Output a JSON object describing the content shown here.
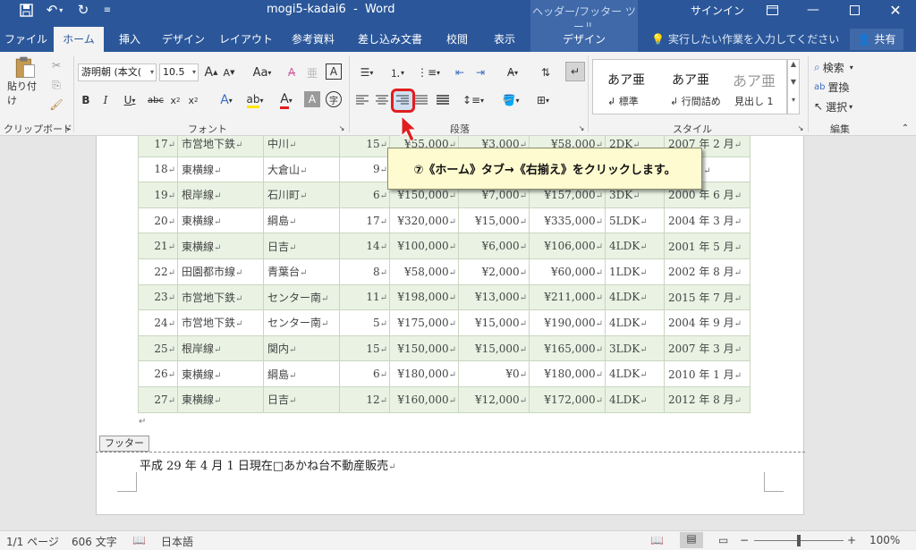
{
  "titlebar": {
    "title": "mogi5-kadai6",
    "separator": "-",
    "app": "Word",
    "context_tools": "ヘッダー/フッター ツール",
    "signin": "サインイン"
  },
  "tabs": [
    "ファイル",
    "ホーム",
    "挿入",
    "デザイン",
    "レイアウト",
    "参考資料",
    "差し込み文書",
    "校閲",
    "表示"
  ],
  "context_tab": "デザイン",
  "tellme": "実行したい作業を入力してください",
  "share": "共有",
  "ribbon": {
    "clipboard": {
      "paste": "貼り付け",
      "label": "クリップボード"
    },
    "font": {
      "name": "游明朝 (本文(",
      "size": "10.5",
      "label": "フォント"
    },
    "paragraph": {
      "label": "段落"
    },
    "styles": {
      "label": "スタイル",
      "items": [
        {
          "preview": "あア亜",
          "name": "標準"
        },
        {
          "preview": "あア亜",
          "name": "行間詰め"
        },
        {
          "preview": "あア亜",
          "name": "見出し 1"
        }
      ]
    },
    "editing": {
      "find": "検索",
      "replace": "置換",
      "select": "選択",
      "label": "編集"
    }
  },
  "table": {
    "rows": [
      [
        "17",
        "市営地下鉄",
        "中川",
        "15",
        "¥55,000",
        "¥3,000",
        "¥58,000",
        "2DK",
        "2007 年 2 月"
      ],
      [
        "18",
        "東横線",
        "大倉山",
        "9",
        "",
        "",
        "",
        "",
        "年 4 月"
      ],
      [
        "19",
        "根岸線",
        "石川町",
        "6",
        "¥150,000",
        "¥7,000",
        "¥157,000",
        "3DK",
        "2000 年 6 月"
      ],
      [
        "20",
        "東横線",
        "綱島",
        "17",
        "¥320,000",
        "¥15,000",
        "¥335,000",
        "5LDK",
        "2004 年 3 月"
      ],
      [
        "21",
        "東横線",
        "日吉",
        "14",
        "¥100,000",
        "¥6,000",
        "¥106,000",
        "4LDK",
        "2001 年 5 月"
      ],
      [
        "22",
        "田園都市線",
        "青葉台",
        "8",
        "¥58,000",
        "¥2,000",
        "¥60,000",
        "1LDK",
        "2002 年 8 月"
      ],
      [
        "23",
        "市営地下鉄",
        "センター南",
        "11",
        "¥198,000",
        "¥13,000",
        "¥211,000",
        "4LDK",
        "2015 年 7 月"
      ],
      [
        "24",
        "市営地下鉄",
        "センター南",
        "5",
        "¥175,000",
        "¥15,000",
        "¥190,000",
        "4LDK",
        "2004 年 9 月"
      ],
      [
        "25",
        "根岸線",
        "関内",
        "15",
        "¥150,000",
        "¥15,000",
        "¥165,000",
        "3LDK",
        "2007 年 3 月"
      ],
      [
        "26",
        "東横線",
        "綱島",
        "6",
        "¥180,000",
        "¥0",
        "¥180,000",
        "4LDK",
        "2010 年 1 月"
      ],
      [
        "27",
        "東横線",
        "日吉",
        "12",
        "¥160,000",
        "¥12,000",
        "¥172,000",
        "4LDK",
        "2012 年 8 月"
      ]
    ]
  },
  "footer": {
    "tag": "フッター",
    "text": "平成 29 年 4 月 1 日現在□あかね台不動産販売"
  },
  "callout": "⑦《ホーム》タブ→《右揃え》をクリックします。",
  "statusbar": {
    "page": "1/1 ページ",
    "words": "606 文字",
    "language": "日本語",
    "zoom": "100%"
  }
}
